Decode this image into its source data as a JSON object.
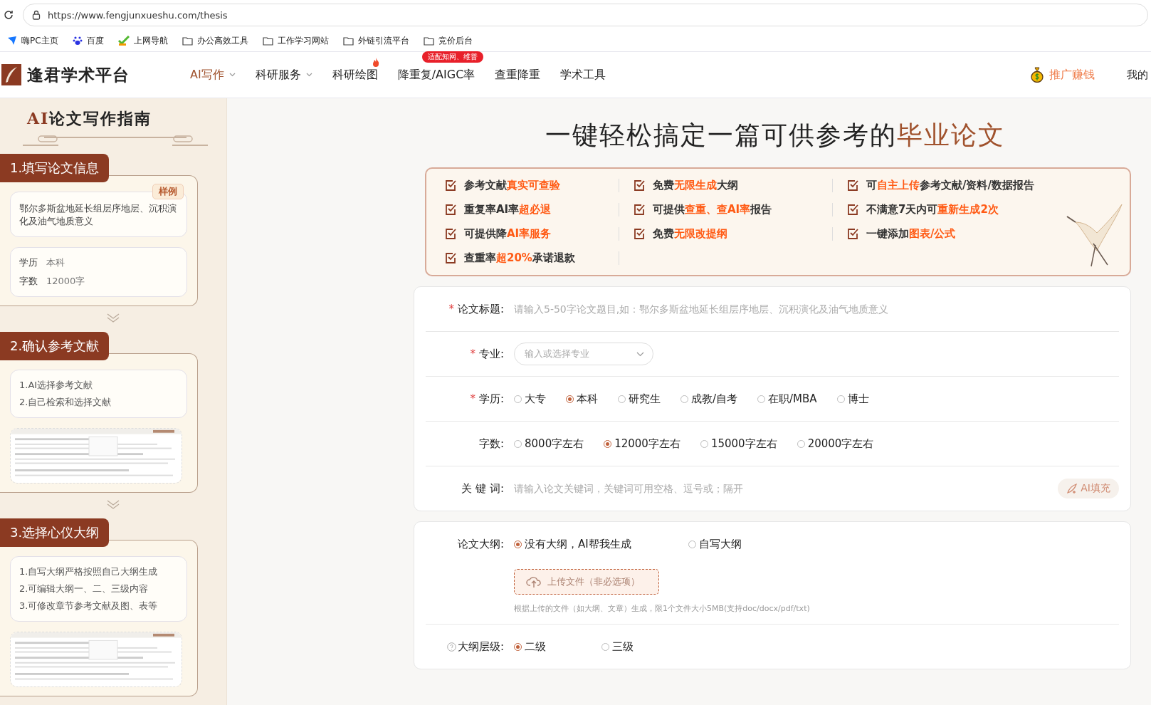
{
  "browser": {
    "url": "https://www.fengjunxueshu.com/thesis",
    "bookmarks": [
      {
        "kind": "site",
        "label": "嗨PC主页"
      },
      {
        "kind": "baidu",
        "label": "百度"
      },
      {
        "kind": "hao",
        "label": "上网导航"
      },
      {
        "kind": "folder",
        "label": "办公高效工具"
      },
      {
        "kind": "folder",
        "label": "工作学习网站"
      },
      {
        "kind": "folder",
        "label": "外链引流平台"
      },
      {
        "kind": "folder",
        "label": "竞价后台"
      }
    ]
  },
  "site": {
    "name": "逢君学术平台",
    "nav": [
      {
        "label": "AI写作",
        "selected": true,
        "dropdown": true
      },
      {
        "label": "科研服务",
        "selected": false,
        "dropdown": true
      },
      {
        "label": "科研绘图",
        "selected": false,
        "dropdown": false,
        "hot": true
      },
      {
        "label": "降重复/AIGC率",
        "selected": false,
        "dropdown": false,
        "badge": "适配知网、维普"
      },
      {
        "label": "查重降重",
        "selected": false,
        "dropdown": false
      },
      {
        "label": "学术工具",
        "selected": false,
        "dropdown": false
      }
    ],
    "promo": "推广赚钱",
    "account": "我的"
  },
  "guide": {
    "title_ai": "AI",
    "title_rest": "论文写作指南",
    "steps": [
      {
        "title": "1.填写论文信息",
        "sample_tag": "样例",
        "sample_text": "鄂尔多斯盆地延长组层序地层、沉积演化及油气地质意义",
        "details": [
          {
            "label": "学历",
            "value": "本科"
          },
          {
            "label": "字数",
            "value": "12000字"
          }
        ]
      },
      {
        "title": "2.确认参考文献",
        "lines": [
          "1.AI选择参考文献",
          "2.自己检索和选择文献"
        ],
        "preview": true
      },
      {
        "title": "3.选择心仪大纲",
        "lines": [
          "1.自写大纲严格按照自己大纲生成",
          "2.可编辑大纲一、二、三级内容",
          "3.可修改章节参考文献及图、表等"
        ],
        "preview": true
      }
    ]
  },
  "headline": {
    "text": "一键轻松搞定一篇可供参考的",
    "highlight": "毕业论文"
  },
  "features": [
    [
      {
        "text": "参考文献",
        "hl": false
      },
      {
        "text": "真实可查验",
        "hl": true
      }
    ],
    [
      {
        "text": "免费",
        "hl": false
      },
      {
        "text": "无限生成",
        "hl": true
      },
      {
        "text": "大纲",
        "hl": false
      }
    ],
    [
      {
        "text": "可",
        "hl": false
      },
      {
        "text": "自主上传",
        "hl": true
      },
      {
        "text": "参考文献/资料/数据报告",
        "hl": false
      }
    ],
    [
      {
        "text": "重复率AI率",
        "hl": false
      },
      {
        "text": "超必退",
        "hl": true
      }
    ],
    [
      {
        "text": "可提供",
        "hl": false
      },
      {
        "text": "查重、查AI率",
        "hl": true
      },
      {
        "text": "报告",
        "hl": false
      }
    ],
    [
      {
        "text": "不满意7天内可",
        "hl": false
      },
      {
        "text": "重新生成2次",
        "hl": true
      }
    ],
    [
      {
        "text": "可提供降",
        "hl": false
      },
      {
        "text": "AI率服务",
        "hl": true
      }
    ],
    [
      {
        "text": "免费",
        "hl": false
      },
      {
        "text": "无限改提纲",
        "hl": true
      }
    ],
    [
      {
        "text": "一键添加",
        "hl": false
      },
      {
        "text": "图表/公式",
        "hl": true
      }
    ],
    [
      {
        "text": "查重率",
        "hl": false
      },
      {
        "text": "超20%",
        "hl": true
      },
      {
        "text": "承诺退款",
        "hl": false
      }
    ]
  ],
  "form": {
    "rows": [
      {
        "kind": "text",
        "label": "论文标题:",
        "required": "*",
        "placeholder": "请输入5-50字论文题目,如：鄂尔多斯盆地延长组层序地层、沉积演化及油气地质意义"
      },
      {
        "kind": "select",
        "label": "专业:",
        "required": "*",
        "placeholder": "输入或选择专业"
      },
      {
        "kind": "radio",
        "label": "学历:",
        "required": "*",
        "options": [
          {
            "label": "大专",
            "selected": false
          },
          {
            "label": "本科",
            "selected": true
          },
          {
            "label": "研究生",
            "selected": false
          },
          {
            "label": "成教/自考",
            "selected": false
          },
          {
            "label": "在职/MBA",
            "selected": false
          },
          {
            "label": "博士",
            "selected": false
          }
        ]
      },
      {
        "kind": "radio",
        "label": "字数:",
        "options": [
          {
            "label": "8000字左右",
            "selected": false
          },
          {
            "label": "12000字左右",
            "selected": true
          },
          {
            "label": "15000字左右",
            "selected": false
          },
          {
            "label": "20000字左右",
            "selected": false
          }
        ]
      },
      {
        "kind": "keywords",
        "label": "关 键 词:",
        "placeholder": "请输入论文关键词，关键词可用空格、逗号或；隔开",
        "button": "AI填充"
      }
    ]
  },
  "outline": {
    "label": "论文大纲:",
    "options": [
      {
        "label": "没有大纲，AI帮我生成",
        "selected": true
      },
      {
        "label": "自写大纲",
        "selected": false
      }
    ],
    "upload": "上传文件（非必选项）",
    "hint": "根据上传的文件（如大纲、文章）生成，限1个文件大小5MB(支持doc/docx/pdf/txt)",
    "level_label": "大纲层级:",
    "levels": [
      {
        "label": "二级",
        "selected": true
      },
      {
        "label": "三级",
        "selected": false
      }
    ]
  }
}
